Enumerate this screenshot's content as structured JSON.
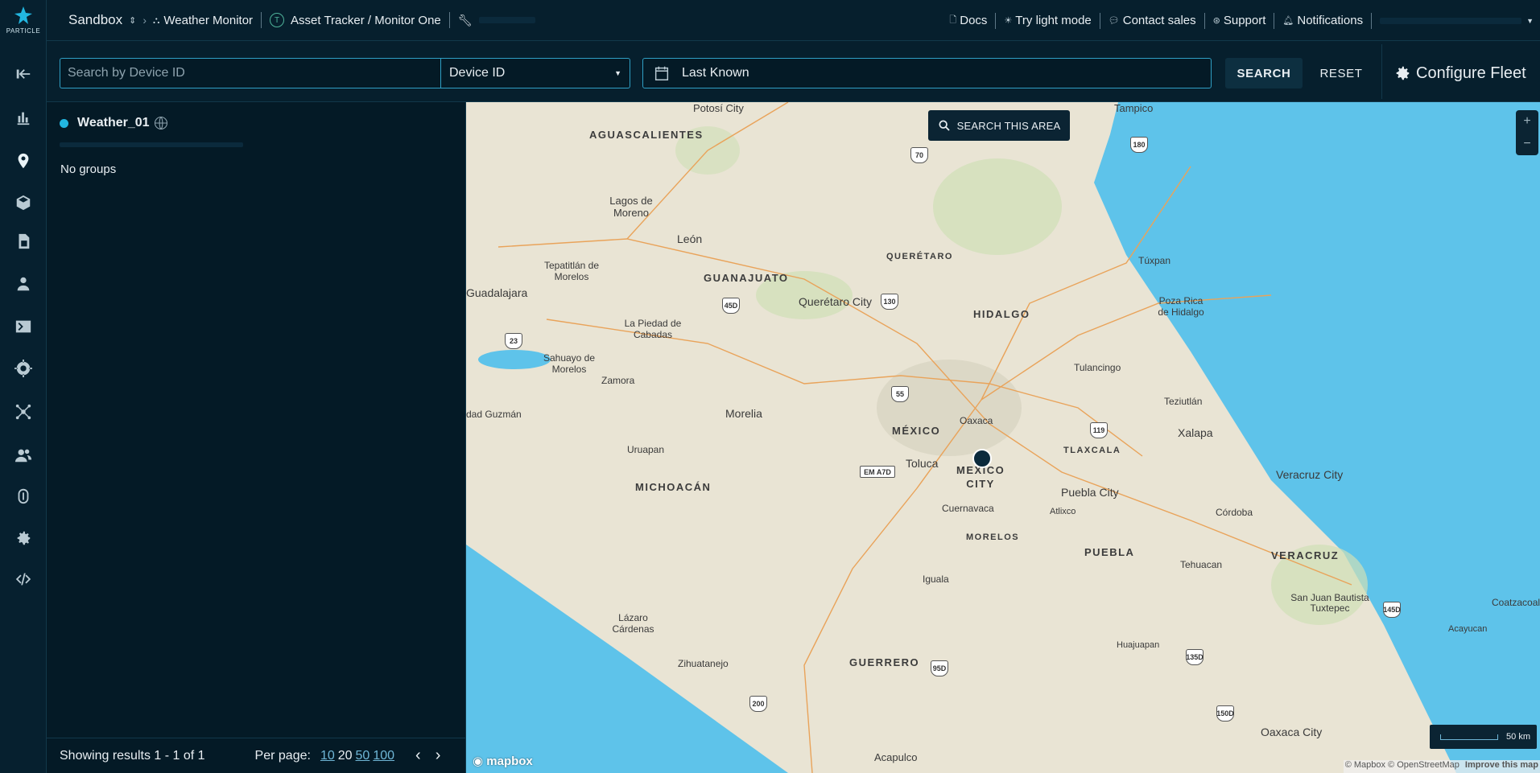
{
  "brand": {
    "name": "PARTICLE"
  },
  "topbar": {
    "org": "Sandbox",
    "product": "Weather Monitor",
    "platform_badge": "T",
    "platform": "Asset Tracker / Monitor One",
    "links": {
      "docs": "Docs",
      "light_mode": "Try light mode",
      "contact": "Contact sales",
      "support": "Support",
      "notifications": "Notifications"
    }
  },
  "nav_icons": [
    "return-icon",
    "chart-icon",
    "location-pin-icon",
    "cube-icon",
    "sim-card-icon",
    "person-icon",
    "terminal-icon",
    "firmware-chip-icon",
    "network-icon",
    "team-icon",
    "fingerprint-icon",
    "gear-icon",
    "code-icon"
  ],
  "search": {
    "placeholder": "Search by Device ID",
    "value": "",
    "field_select": "Device ID",
    "date": "Last Known",
    "search_btn": "SEARCH",
    "reset_btn": "RESET",
    "configure": "Configure Fleet"
  },
  "panel": {
    "device_name": "Weather_01",
    "groups": "No groups",
    "results": "Showing results 1 - 1 of 1",
    "per_page_label": "Per page:",
    "per_page": [
      "10",
      "20",
      "50",
      "100"
    ]
  },
  "map": {
    "search_area": "SEARCH THIS AREA",
    "scale": "50 km",
    "attribution": "© Mapbox © OpenStreetMap",
    "improve": "Improve this map",
    "logo": "mapbox",
    "labels": [
      "Potosí City",
      "AGUASCALIENTES",
      "Tampico",
      "Lagos de Moreno",
      "León",
      "GUANAJUATO",
      "QUERÉTARO",
      "Túxpan",
      "Tepatitlán de Morelos",
      "Guadalajara",
      "Querétaro City",
      "HIDALGO",
      "Poza Rica de Hidalgo",
      "La Piedad de Cabadas",
      "Sahuayo de Morelos",
      "Zamora",
      "Tulancingo",
      "Teziutlán",
      "dad Guzmán",
      "Morelia",
      "MÉXICO",
      "Oaxaca",
      "Xalapa",
      "Uruapan",
      "Toluca",
      "MEXICO CITY",
      "TLAXCALA",
      "Veracruz City",
      "MICHOACÁN",
      "Cuernavaca",
      "Puebla City",
      "Atlixco",
      "Córdoba",
      "MORELOS",
      "PUEBLA",
      "Tehuacan",
      "VERACRUZ",
      "Iguala",
      "San Juan Bautista Tuxtepec",
      "Coatzacoal",
      "Acayucan",
      "Lázaro Cárdenas",
      "Zihuatanejo",
      "GUERRERO",
      "Huajuapan",
      "Oaxaca City",
      "Acapulco"
    ],
    "shields": [
      "70",
      "180",
      "45D",
      "130",
      "23",
      "55",
      "EM A7D",
      "119",
      "145D",
      "95D",
      "135D",
      "150D",
      "200"
    ]
  }
}
